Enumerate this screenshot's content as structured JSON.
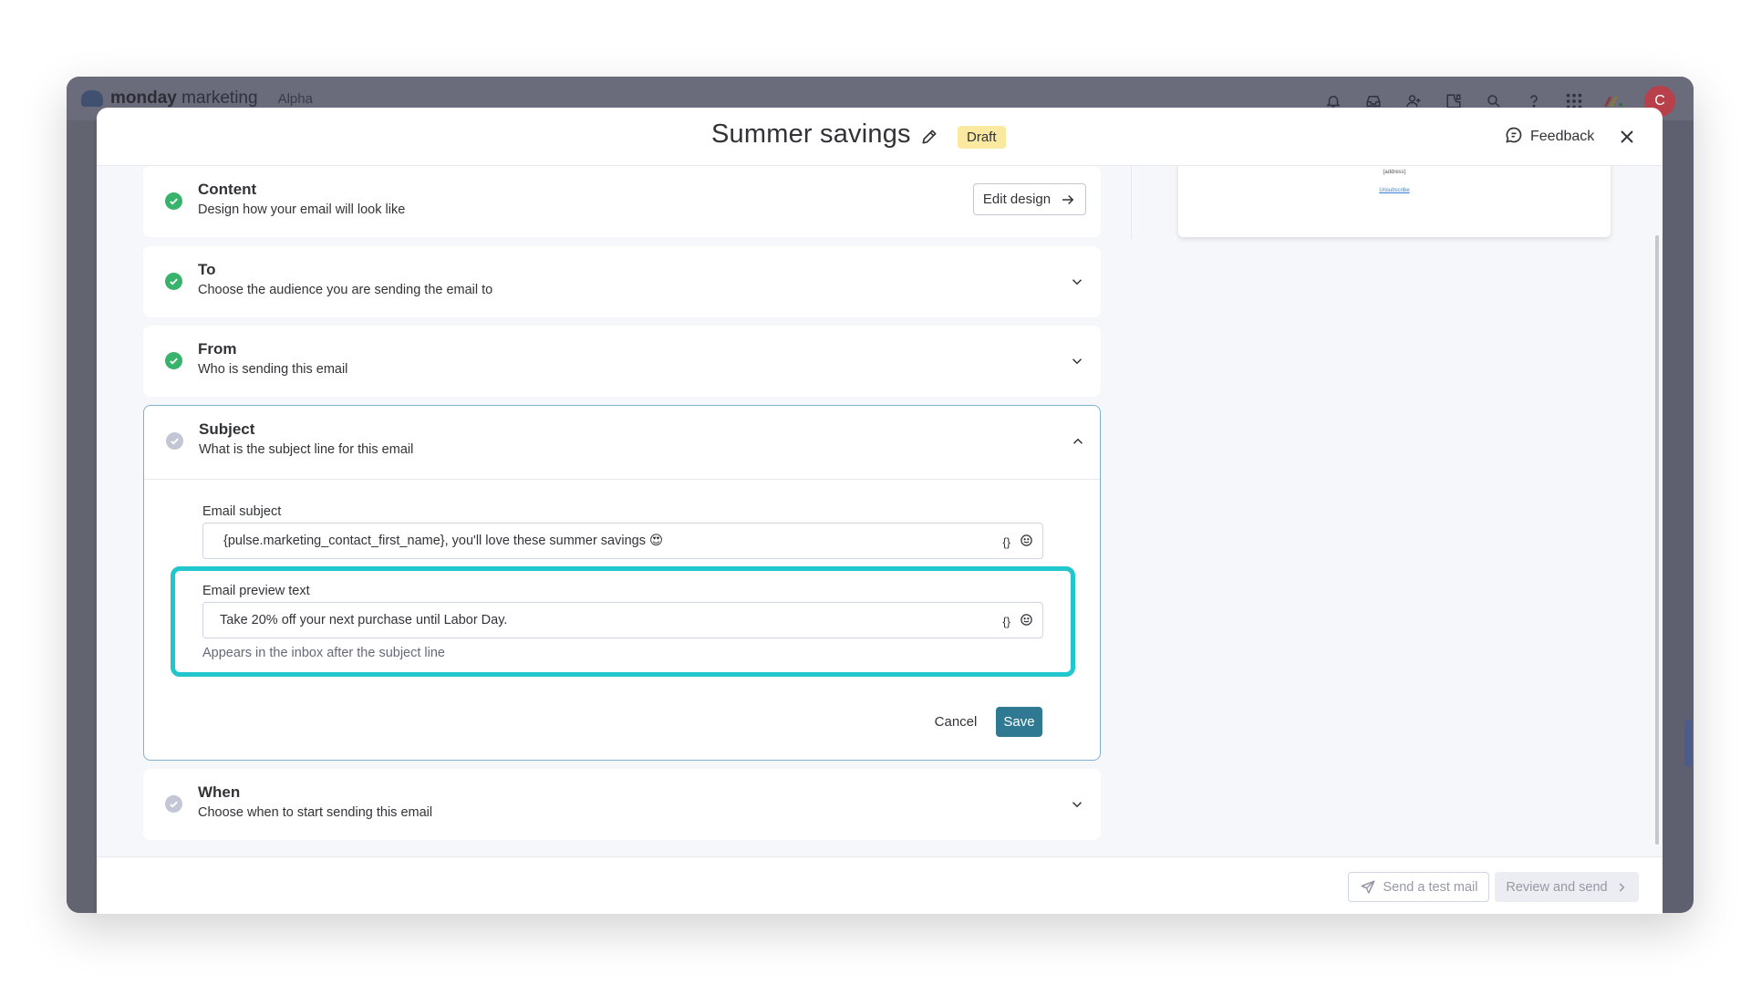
{
  "app": {
    "brand_bold": "monday",
    "brand_light": " marketing",
    "badge": "Alpha",
    "avatar_initial": "C",
    "top_icons": [
      "bell-icon",
      "inbox-icon",
      "invite-user-icon",
      "integrations-icon",
      "search-icon",
      "help-icon",
      "apps-grid-icon",
      "product-switcher-icon"
    ]
  },
  "modal": {
    "title": "Summer savings",
    "status_badge": "Draft",
    "feedback_label": "Feedback",
    "colors": {
      "accent": "#2f7a92",
      "success": "#38b36b",
      "highlight": "#21c7cc",
      "draft_bg": "#fbe9a0"
    }
  },
  "preview": {
    "address_text": "{address}",
    "unsubscribe_text": "Unsubscribe"
  },
  "steps": {
    "content": {
      "title": "Content",
      "description": "Design how your email will look like",
      "button_label": "Edit design",
      "status": "done"
    },
    "to": {
      "title": "To",
      "description": "Choose the audience you are sending the email to",
      "status": "done"
    },
    "from": {
      "title": "From",
      "description": "Who is sending this email",
      "status": "done"
    },
    "subject": {
      "title": "Subject",
      "description": "What is the subject line for this email",
      "status": "pending",
      "email_subject_label": "Email subject",
      "email_subject_value": "{pulse.marketing_contact_first_name}, you'll love these summer savings 😍",
      "preview_text_label": "Email preview text",
      "preview_text_value": "Take 20% off your next purchase until Labor Day.",
      "preview_text_hint": "Appears in the inbox after the subject line",
      "variable_tool": "{}",
      "cancel_label": "Cancel",
      "save_label": "Save"
    },
    "when": {
      "title": "When",
      "description": "Choose when to start sending this email",
      "status": "pending"
    }
  },
  "footer": {
    "send_test_label": "Send a test mail",
    "review_send_label": "Review and send"
  }
}
